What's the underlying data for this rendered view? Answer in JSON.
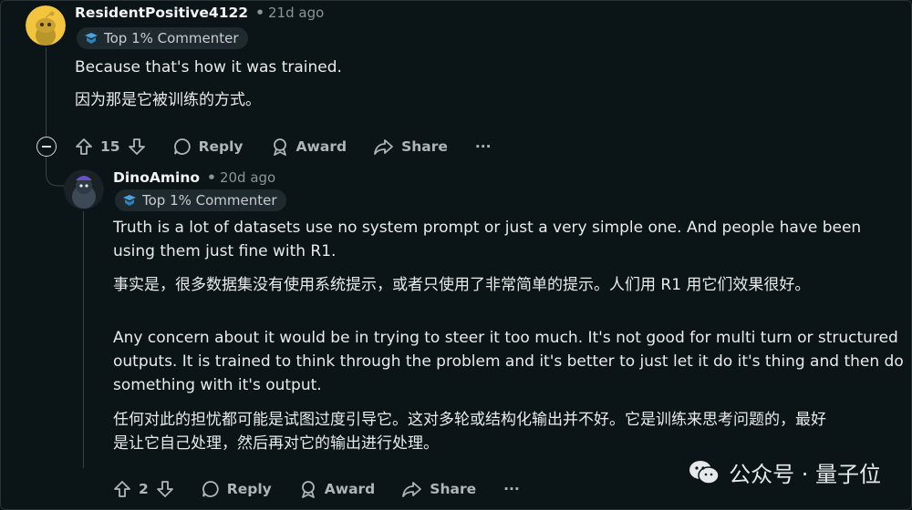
{
  "comment1": {
    "username": "ResidentPositive4122",
    "time": "21d ago",
    "badge": "Top 1% Commenter",
    "lines": [
      "Because that's how it was trained.",
      "因为那是它被训练的方式。"
    ],
    "votes": "15",
    "actions": {
      "reply": "Reply",
      "award": "Award",
      "share": "Share",
      "more": "···"
    }
  },
  "comment2": {
    "username": "DinoAmino",
    "time": "20d ago",
    "badge": "Top 1% Commenter",
    "para1": [
      "Truth is a lot of datasets use no system prompt or just a very simple one. And people have been",
      "using them just fine with R1."
    ],
    "para1_cn": "事实是，很多数据集没有使用系统提示，或者只使用了非常简单的提示。人们用 R1 用它们效果很好。",
    "para2": [
      "Any concern about it would be in trying to steer it too much. It's not good for multi turn or structured",
      "outputs. It is trained to think through the problem and it's better to just let it do it's thing and then do",
      "something with it's output."
    ],
    "para2_cn": [
      "任何对此的担忧都可能是试图过度引导它。这对多轮或结构化输出并不好。它是训练来思考问题的，最好",
      "是让它自己处理，然后再对它的输出进行处理。"
    ],
    "votes": "2",
    "actions": {
      "reply": "Reply",
      "award": "Award",
      "share": "Share",
      "more": "···"
    }
  },
  "watermark": {
    "text": "公众号 · 量子位"
  }
}
